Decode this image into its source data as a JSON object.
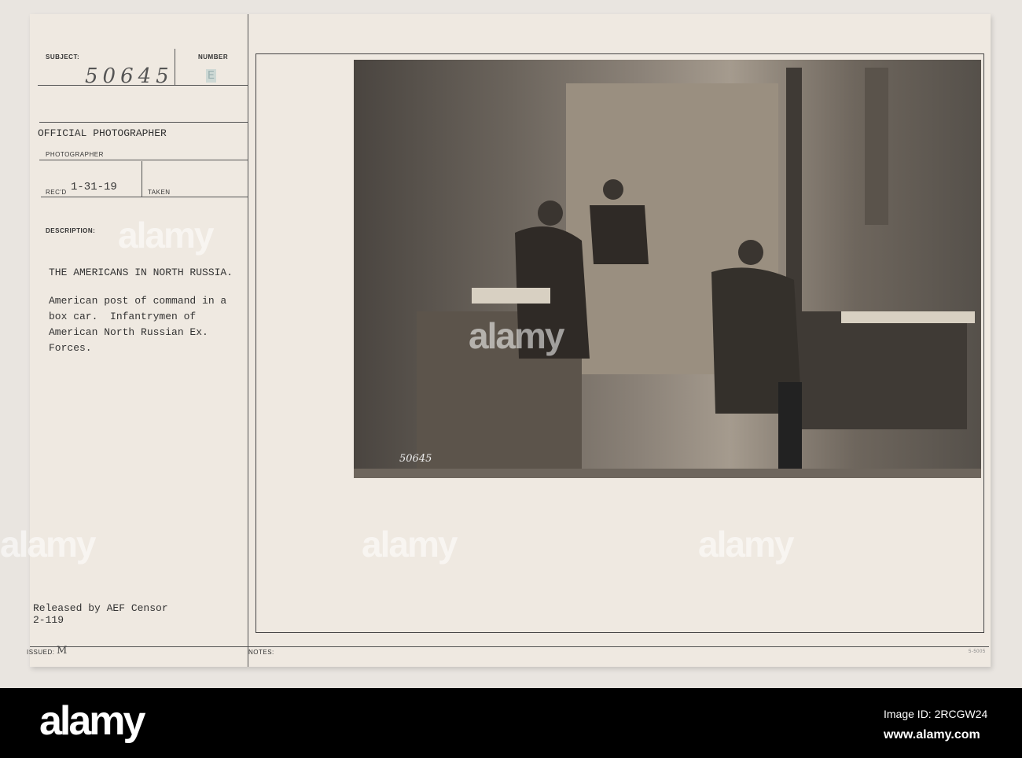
{
  "card": {
    "subject_label": "SUBJECT:",
    "subject_number": "50645",
    "number_label": "NUMBER",
    "number_stamp": "E",
    "photographer_value": "OFFICIAL PHOTOGRAPHER",
    "photographer_label": "PHOTOGRAPHER",
    "recd_label": "REC'D",
    "recd_value": "1-31-19",
    "taken_label": "TAKEN",
    "description_label": "DESCRIPTION:",
    "description_title": "THE AMERICANS IN NORTH RUSSIA.",
    "description_lines": [
      "American post of command in a",
      "box car.  Infantrymen of",
      "American North Russian Ex.",
      "Forces."
    ],
    "released_line1": "Released by AEF Censor",
    "released_line2": "2-119",
    "issued_label": "ISSUED:",
    "issued_value": "M",
    "notes_label": "NOTES:",
    "form_number": "5-5005",
    "photo_stamp": "50645"
  },
  "watermark": "alamy",
  "footer": {
    "logo": "alamy",
    "image_id": "Image ID: 2RCGW24",
    "url": "www.alamy.com"
  }
}
